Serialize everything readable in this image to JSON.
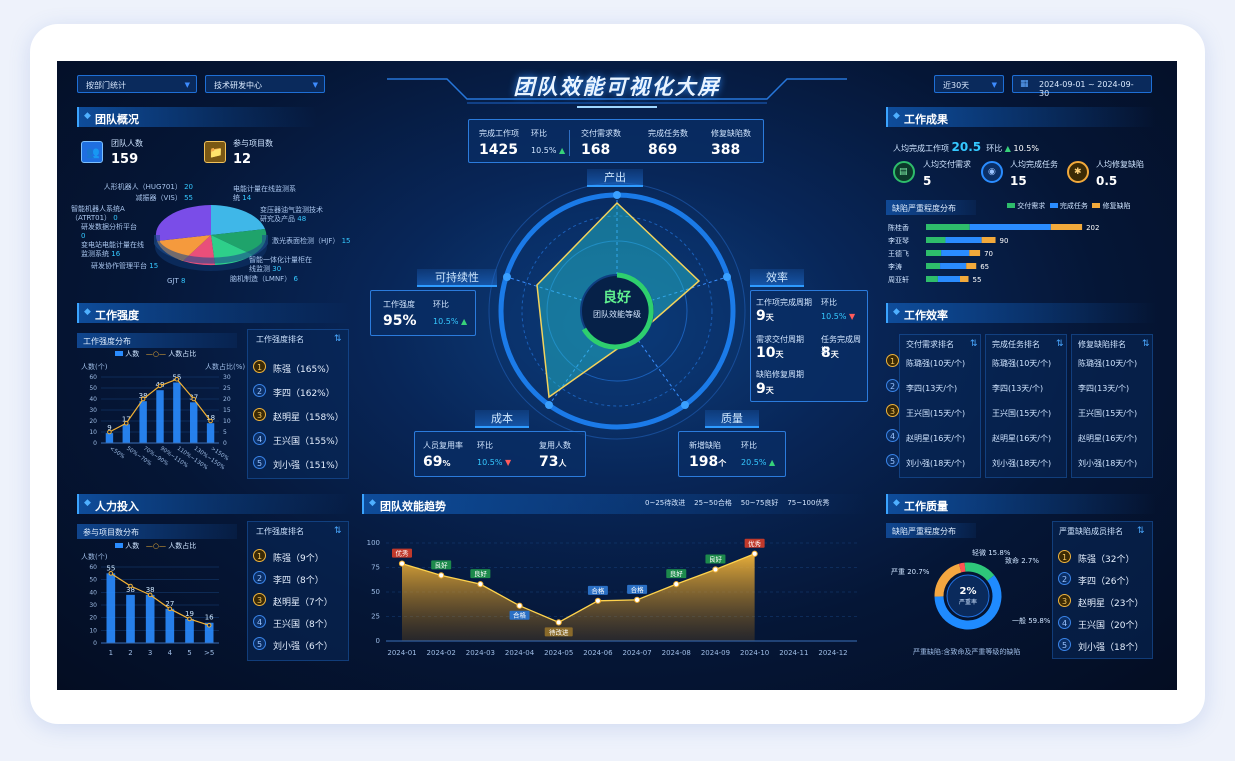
{
  "header": {
    "title": "团队效能可视化大屏",
    "dept_select": "按部门统计",
    "center_select": "技术研发中心",
    "range_select": "近30天",
    "date_range": "2024-09-01 ~ 2024-09-30"
  },
  "overview": {
    "title": "团队概况",
    "members_label": "团队人数",
    "members": "159",
    "projects_label": "参与项目数",
    "projects": "12",
    "pie_labels": [
      {
        "name": "人形机器人（HUG701）",
        "value": "20"
      },
      {
        "name": "减振器（VIS）",
        "value": "55"
      },
      {
        "name": "智能机器人系统A（ATRT01）",
        "value": "0"
      },
      {
        "name": "研发数据分析平台",
        "value": "0"
      },
      {
        "name": "变电站电能计量在线监测系统",
        "value": "16"
      },
      {
        "name": "研发协作管理平台",
        "value": "15"
      },
      {
        "name": "GJT",
        "value": "8"
      },
      {
        "name": "电能计量在线监测系统",
        "value": "14"
      },
      {
        "name": "变压器油气监测技术研究及产品",
        "value": "48"
      },
      {
        "name": "激光表面检测（HJF）",
        "value": "15"
      },
      {
        "name": "智能一体化计量柜在线监测",
        "value": "30"
      },
      {
        "name": "脑机制造（LMNF）",
        "value": "6"
      }
    ]
  },
  "intensity": {
    "title": "工作强度",
    "dist_title": "工作强度分布",
    "legend_count": "人数",
    "legend_ratio": "人数占比",
    "y_left_label": "人数(个)",
    "y_right_label": "人数占比(%)",
    "rank_title": "工作强度排名",
    "rank": [
      {
        "no": "1",
        "text": "陈强（165%）"
      },
      {
        "no": "2",
        "text": "李四（162%）"
      },
      {
        "no": "3",
        "text": "赵明星（158%）"
      },
      {
        "no": "4",
        "text": "王兴国（155%）"
      },
      {
        "no": "5",
        "text": "刘小强（151%）"
      }
    ]
  },
  "intensity_chart": {
    "type": "bar",
    "categories": [
      "<50%",
      "50%~70%",
      "70%~90%",
      "90%~110%",
      "110%~130%",
      "130%~150%",
      ">150%"
    ],
    "values": [
      9,
      17,
      38,
      48,
      55,
      37,
      18
    ],
    "ratio": [
      5,
      9,
      20,
      26,
      29,
      20,
      10
    ],
    "ylim": [
      0,
      60
    ],
    "y_ticks": [
      "0",
      "10",
      "20",
      "30",
      "40",
      "50",
      "60"
    ],
    "y2_ticks": [
      "0",
      "5",
      "10",
      "15",
      "20",
      "25",
      "30"
    ]
  },
  "manpower": {
    "title": "人力投入",
    "dist_title": "参与项目数分布",
    "legend_count": "人数",
    "legend_ratio": "人数占比",
    "y_left_label": "人数(个)",
    "rank_title": "工作强度排名",
    "rank": [
      {
        "no": "1",
        "text": "陈强（9个）"
      },
      {
        "no": "2",
        "text": "李四（8个）"
      },
      {
        "no": "3",
        "text": "赵明星（7个）"
      },
      {
        "no": "4",
        "text": "王兴国（8个）"
      },
      {
        "no": "5",
        "text": "刘小强（6个）"
      }
    ]
  },
  "manpower_chart": {
    "type": "bar",
    "categories": [
      "1",
      "2",
      "3",
      "4",
      "5",
      ">5"
    ],
    "values": [
      55,
      38,
      38,
      27,
      19,
      16
    ],
    "ratio": [
      55,
      45,
      38,
      27,
      19,
      14
    ],
    "ylim": [
      0,
      60
    ],
    "y_ticks": [
      "0",
      "10",
      "20",
      "30",
      "40",
      "50",
      "60"
    ]
  },
  "center": {
    "kpi": [
      {
        "label": "完成工作项",
        "value": "1425"
      },
      {
        "label": "环比",
        "value": "10.5%"
      },
      {
        "label": "交付需求数",
        "value": "168"
      },
      {
        "label": "完成任务数",
        "value": "869"
      },
      {
        "label": "修复缺陷数",
        "value": "388"
      }
    ],
    "tag_output": "产出",
    "tag_sustain": "可持续性",
    "tag_efficiency": "效率",
    "tag_cost": "成本",
    "tag_quality": "质量",
    "grade": "良好",
    "grade_label": "团队效能等级",
    "sustain_card": {
      "l1": "工作强度",
      "l2": "环比",
      "v1": "95%",
      "v2": "10.5%"
    },
    "eff_card": {
      "l1": "工作项完成周期",
      "l2": "环比",
      "v1": "9",
      "v1u": "天",
      "v2": "10.5%",
      "l3": "需求交付周期",
      "l4": "任务完成周期",
      "v3": "10",
      "v3u": "天",
      "v4": "8",
      "v4u": "天",
      "l5": "缺陷修复周期",
      "v5": "9",
      "v5u": "天"
    },
    "cost_card": {
      "l1": "人员复用率",
      "l2": "环比",
      "l3": "复用人数",
      "v1": "69",
      "v1u": "%",
      "v2": "10.5%",
      "v3": "73",
      "v3u": "人"
    },
    "quality_card": {
      "l1": "新增缺陷",
      "l2": "环比",
      "v1": "198",
      "v1u": "个",
      "v2": "20.5%"
    }
  },
  "trend": {
    "title": "团队效能趋势",
    "legend": [
      "0~25待改进",
      "25~50合格",
      "50~75良好",
      "75~100优秀"
    ],
    "y_ticks": [
      "0",
      "25",
      "50",
      "75",
      "100"
    ]
  },
  "chart_data": {
    "type": "area",
    "x": [
      "2024-01",
      "2024-02",
      "2024-03",
      "2024-04",
      "2024-05",
      "2024-06",
      "2024-07",
      "2024-08",
      "2024-09",
      "2024-10",
      "2024-11",
      "2024-12"
    ],
    "values": [
      79,
      67,
      58,
      36,
      19,
      41,
      42,
      58,
      73,
      89
    ],
    "point_labels": [
      "优秀",
      "良好",
      "良好",
      "合格",
      "待改进",
      "合格",
      "合格",
      "良好",
      "良好",
      "优秀"
    ],
    "ylim": [
      0,
      100
    ]
  },
  "results": {
    "title": "工作成果",
    "avg_label": "人均完成工作项",
    "avg": "20.5",
    "mom_label": "环比",
    "mom": "10.5%",
    "items": [
      {
        "label": "人均交付需求",
        "value": "5"
      },
      {
        "label": "人均完成任务",
        "value": "15"
      },
      {
        "label": "人均修复缺陷",
        "value": "0.5"
      }
    ],
    "dist_title": "缺陷严重程度分布",
    "legend": [
      "交付需求",
      "完成任务",
      "修复缺陷"
    ]
  },
  "results_chart": {
    "type": "bar",
    "categories": [
      "陈桂香",
      "李亚琴",
      "王德飞",
      "李涛",
      "周亚轩"
    ],
    "values": [
      202,
      90,
      70,
      65,
      55
    ],
    "colors": [
      "#2ebd6b",
      "#2a8cff",
      "#f2a93b"
    ]
  },
  "efficiency": {
    "title": "工作效率",
    "cols": [
      {
        "title": "交付需求排名",
        "rows": [
          "陈璐强(10天/个)",
          "李四(13天/个)",
          "王兴国(15天/个)",
          "赵明星(16天/个)",
          "刘小强(18天/个)"
        ]
      },
      {
        "title": "完成任务排名",
        "rows": [
          "陈璐强(10天/个)",
          "李四(13天/个)",
          "王兴国(15天/个)",
          "赵明星(16天/个)",
          "刘小强(18天/个)"
        ]
      },
      {
        "title": "修复缺陷排名",
        "rows": [
          "陈璐强(10天/个)",
          "李四(13天/个)",
          "王兴国(15天/个)",
          "赵明星(16天/个)",
          "刘小强(18天/个)"
        ]
      }
    ],
    "nums": [
      "1",
      "2",
      "3",
      "4",
      "5"
    ]
  },
  "quality": {
    "title": "工作质量",
    "dist_title": "缺陷严重程度分布",
    "donut_center": "2%",
    "donut_center_label": "严重率",
    "labels": [
      "轻微 15.8%",
      "致命 2.7%",
      "严重 20.7%",
      "一般 59.8%"
    ],
    "note": "严重缺陷:含致命及严重等级的缺陷",
    "rank_title": "严重缺陷成员排名",
    "rank": [
      {
        "no": "1",
        "text": "陈强（32个）"
      },
      {
        "no": "2",
        "text": "李四（26个）"
      },
      {
        "no": "3",
        "text": "赵明星（23个）"
      },
      {
        "no": "4",
        "text": "王兴国（20个）"
      },
      {
        "no": "5",
        "text": "刘小强（18个）"
      }
    ]
  },
  "quality_chart": {
    "type": "pie",
    "categories": [
      "一般",
      "严重",
      "致命",
      "轻微"
    ],
    "values": [
      59.8,
      20.7,
      2.7,
      15.8
    ],
    "colors": [
      "#1f8bff",
      "#f4a640",
      "#ff5252",
      "#2ec77a"
    ]
  },
  "colors": {
    "accent": "#2e9bff",
    "gold": "#f2b134",
    "green": "#37d27a",
    "red": "#ff5b5b"
  }
}
